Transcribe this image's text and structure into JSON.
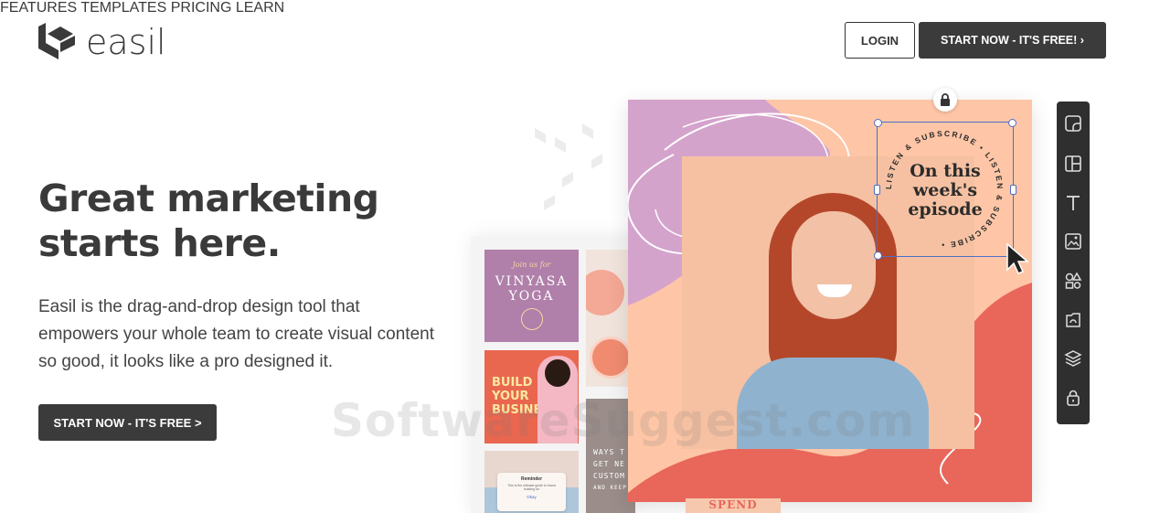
{
  "brand": {
    "name": "easil"
  },
  "nav": {
    "items": [
      "FEATURES",
      "TEMPLATES",
      "PRICING",
      "LEARN"
    ],
    "login_label": "LOGIN",
    "start_label": "START NOW - IT'S FREE! ›"
  },
  "hero": {
    "headline_line1": "Great marketing",
    "headline_line2": "starts here.",
    "description": "Easil is the drag-and-drop design tool that empowers your whole team to create visual content so good, it looks like a pro designed it.",
    "cta_label": "START NOW - IT'S FREE >"
  },
  "artwork": {
    "badge_line1": "On this",
    "badge_line2": "week's",
    "badge_line3": "episode",
    "badge_ring": "LISTEN & SUBSCRIBE • LISTEN & SUBSCRIBE •",
    "thumb1_script": "Join us for",
    "thumb1_title1": "VINYASA",
    "thumb1_title2": "YOGA",
    "thumb2_line1": "BUILD",
    "thumb2_line2": "YOUR",
    "thumb2_line3": "BUSINESS",
    "thumb3_title": "Reminder",
    "thumb3_body": "This is the ultimate guide to brand building for",
    "thumb3_link": "Okay",
    "thumb4_line1": "WAYS T",
    "thumb4_line2": "GET NE",
    "thumb4_line3": "CUSTOM",
    "thumb4_small": "AND KEEP",
    "bottom_tag": "SPEND",
    "toolbar_icons": [
      "sticker-icon",
      "layout-icon",
      "text-icon",
      "image-icon",
      "shapes-icon",
      "upload-icon",
      "layers-icon",
      "lock-icon"
    ]
  },
  "watermark": "SoftwareSuggest.com",
  "colors": {
    "dark": "#3b3b3b",
    "peach": "#fec6a6",
    "coral": "#e8675a",
    "lilac": "#d4a3cc",
    "selection": "#4b6fc7"
  }
}
